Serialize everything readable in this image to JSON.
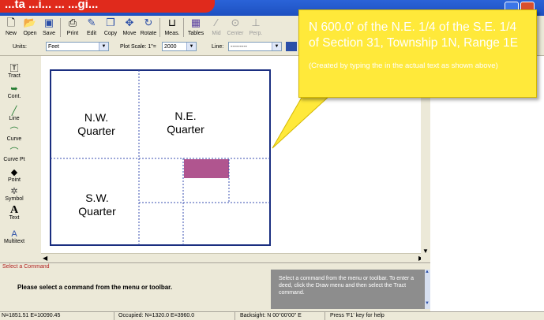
{
  "title_banner": "...ta ...i... ... ...gi...",
  "toolbar": {
    "buttons": [
      {
        "label": "New",
        "icon": "new-file-icon"
      },
      {
        "label": "Open",
        "icon": "open-folder-icon"
      },
      {
        "label": "Save",
        "icon": "save-icon"
      },
      {
        "label": "Print",
        "icon": "printer-icon"
      },
      {
        "label": "Edit",
        "icon": "edit-icon"
      },
      {
        "label": "Copy",
        "icon": "copy-icon"
      },
      {
        "label": "Move",
        "icon": "move-icon"
      },
      {
        "label": "Rotate",
        "icon": "rotate-icon"
      },
      {
        "label": "Meas.",
        "icon": "measure-icon"
      },
      {
        "label": "Tables",
        "icon": "table-icon"
      },
      {
        "label": "Mid",
        "icon": "midpoint-icon"
      },
      {
        "label": "Center",
        "icon": "center-icon"
      },
      {
        "label": "Perp.",
        "icon": "perpendicular-icon"
      }
    ]
  },
  "options": {
    "units_label": "Units:",
    "units_value": "Feet",
    "plot_scale_label": "Plot Scale: 1\"=",
    "plot_scale_value": "2000",
    "line_label": "Line:",
    "line_value": "---------"
  },
  "palette": [
    {
      "label": "Tract",
      "icon": "tract-icon"
    },
    {
      "label": "Cont.",
      "icon": "continue-icon"
    },
    {
      "label": "Line",
      "icon": "line-icon"
    },
    {
      "label": "Curve",
      "icon": "curve-icon"
    },
    {
      "label": "Curve Pt",
      "icon": "curve-point-icon"
    },
    {
      "label": "Point",
      "icon": "point-icon"
    },
    {
      "label": "Symbol",
      "icon": "symbol-icon"
    },
    {
      "label": "Text",
      "icon": "text-icon"
    },
    {
      "label": "Multitext",
      "icon": "multitext-icon"
    }
  ],
  "drawing": {
    "nw": "N.W.\nQuarter",
    "ne": "N.E.\nQuarter",
    "sw": "S.W.\nQuarter",
    "highlight_color": "#b0558f"
  },
  "command": {
    "header": "Select a Command",
    "message": "Please select a command from the menu or toolbar.",
    "help": "Select a command from the menu or toolbar. To enter a deed, click the Draw menu and then select the Tract command."
  },
  "statusbar": {
    "coords": "N=1851.51 E=10090.45",
    "occupied": "Occupied: N=1320.0 E=3960.0",
    "backsight": "Backsight: N 00°00'00\" E",
    "help": "Press 'F1' key for help"
  },
  "callout": {
    "main": "N 600.0' of the N.E. 1/4 of the S.E. 1/4 of Section 31, Township 1N, Range 1E",
    "sub": "(Created by typing the in the actual text as shown above)"
  }
}
